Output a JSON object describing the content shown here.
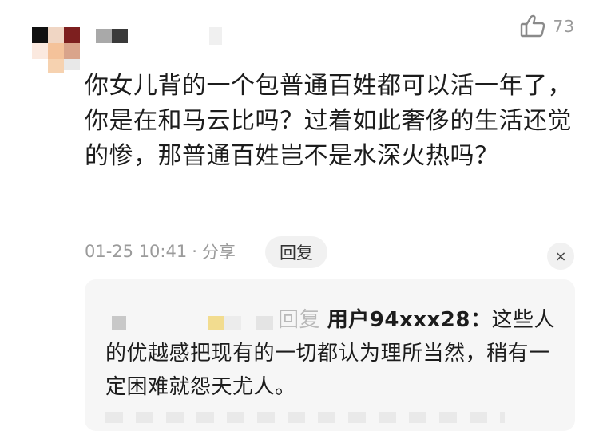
{
  "like": {
    "icon": "thumbs-up-icon",
    "count": "73"
  },
  "comment": {
    "text": "你女儿背的一个包普通百姓都可以活一年了，你是在和马云比吗？过着如此奢侈的生活还觉的惨，那普通百姓岂不是水深火热吗？",
    "time": "01-25 10:41",
    "separator": "·",
    "share": "分享",
    "reply_label": "回复",
    "close_symbol": "×"
  },
  "reply": {
    "prefix": "回复",
    "target": "用户94xxx28：",
    "text": "这些人的优越感把现有的一切都认为理所当然，稍有一定困难就怨天尤人。"
  },
  "colors": {
    "background": "#ffffff",
    "reply_bg": "#f6f6f6",
    "meta": "#9b9b9b"
  }
}
